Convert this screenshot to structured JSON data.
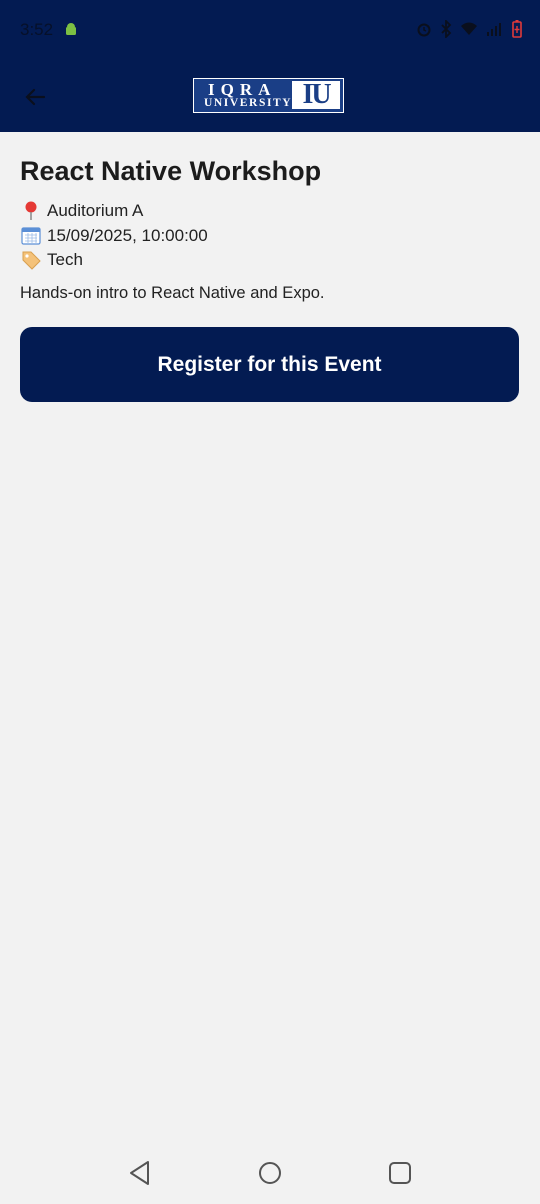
{
  "status_bar": {
    "time": "3:52",
    "icons": [
      "android-icon",
      "alarm-icon",
      "bluetooth-icon",
      "wifi-icon",
      "signal-icon",
      "battery-icon"
    ]
  },
  "app_bar": {
    "back_icon": "arrow-left-icon",
    "logo": {
      "line1": "IQRA",
      "line2": "UNIVERSITY",
      "mark": "IU"
    }
  },
  "event": {
    "title": "React Native Workshop",
    "location": "Auditorium A",
    "datetime": "15/09/2025, 10:00:00",
    "category": "Tech",
    "description": "Hands-on intro to React Native and Expo.",
    "location_icon": "pin-icon",
    "date_icon": "calendar-icon",
    "category_icon": "tag-icon"
  },
  "register_button": {
    "label": "Register for this Event"
  },
  "nav_bar": {
    "buttons": [
      "back-triangle-icon",
      "home-circle-icon",
      "recents-square-icon"
    ]
  },
  "colors": {
    "primary": "#031b52",
    "background": "#f2f2f2",
    "text": "#1c1c1c"
  }
}
